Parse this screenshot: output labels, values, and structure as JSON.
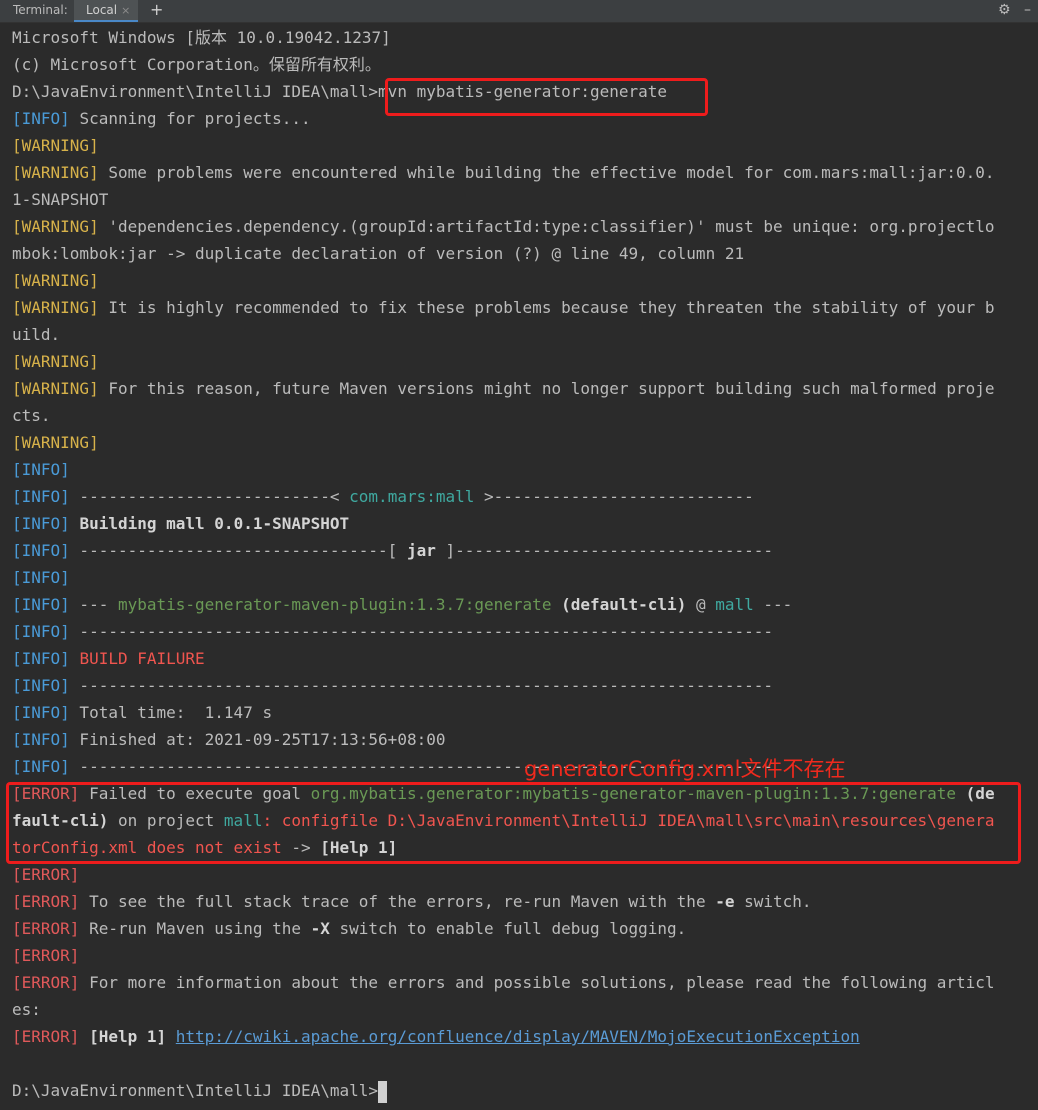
{
  "tabbar": {
    "title": "Terminal:",
    "tab_label": "Local",
    "tab_close": "×",
    "add": "+",
    "settings_icon": "gear-icon",
    "minimize_icon": "minimize-icon"
  },
  "lines": [
    {
      "segments": [
        {
          "t": "Microsoft Windows [版本 10.0.19042.1237]"
        }
      ]
    },
    {
      "segments": [
        {
          "t": "(c) Microsoft Corporation。保留所有权利。"
        }
      ]
    },
    {
      "segments": [
        {
          "t": "D:\\JavaEnvironment\\IntelliJ IDEA\\mall>mvn mybatis-generator:generate"
        }
      ]
    },
    {
      "segments": [
        {
          "t": "[",
          "c": "info"
        },
        {
          "t": "INFO",
          "c": "info"
        },
        {
          "t": "]",
          "c": "info"
        },
        {
          "t": " Scanning for projects..."
        }
      ]
    },
    {
      "segments": [
        {
          "t": "[WARNING]",
          "c": "warn"
        }
      ]
    },
    {
      "segments": [
        {
          "t": "[WARNING]",
          "c": "warn"
        },
        {
          "t": " Some problems were encountered while building the effective model for com.mars:mall:jar:0.0."
        }
      ]
    },
    {
      "segments": [
        {
          "t": "1-SNAPSHOT"
        }
      ]
    },
    {
      "segments": [
        {
          "t": "[WARNING]",
          "c": "warn"
        },
        {
          "t": " 'dependencies.dependency.(groupId:artifactId:type:classifier)' must be unique: org.projectlo"
        }
      ]
    },
    {
      "segments": [
        {
          "t": "mbok:lombok:jar -> duplicate declaration of version (?) @ line 49, column 21"
        }
      ]
    },
    {
      "segments": [
        {
          "t": "[WARNING]",
          "c": "warn"
        }
      ]
    },
    {
      "segments": [
        {
          "t": "[WARNING]",
          "c": "warn"
        },
        {
          "t": " It is highly recommended to fix these problems because they threaten the stability of your b"
        }
      ]
    },
    {
      "segments": [
        {
          "t": "uild."
        }
      ]
    },
    {
      "segments": [
        {
          "t": "[WARNING]",
          "c": "warn"
        }
      ]
    },
    {
      "segments": [
        {
          "t": "[WARNING]",
          "c": "warn"
        },
        {
          "t": " For this reason, future Maven versions might no longer support building such malformed proje"
        }
      ]
    },
    {
      "segments": [
        {
          "t": "cts."
        }
      ]
    },
    {
      "segments": [
        {
          "t": "[WARNING]",
          "c": "warn"
        }
      ]
    },
    {
      "segments": [
        {
          "t": "[INFO]",
          "c": "info"
        }
      ]
    },
    {
      "segments": [
        {
          "t": "[INFO]",
          "c": "info"
        },
        {
          "t": " --------------------------< "
        },
        {
          "t": "com.mars:mall",
          "c": "teal"
        },
        {
          "t": " >---------------------------"
        }
      ]
    },
    {
      "segments": [
        {
          "t": "[INFO]",
          "c": "info"
        },
        {
          "t": " "
        },
        {
          "t": "Building mall 0.0.1-SNAPSHOT",
          "c": "bold"
        }
      ]
    },
    {
      "segments": [
        {
          "t": "[INFO]",
          "c": "info"
        },
        {
          "t": " --------------------------------[ "
        },
        {
          "t": "jar",
          "c": "bold"
        },
        {
          "t": " ]---------------------------------"
        }
      ]
    },
    {
      "segments": [
        {
          "t": "[INFO]",
          "c": "info"
        }
      ]
    },
    {
      "segments": [
        {
          "t": "[INFO]",
          "c": "info"
        },
        {
          "t": " --- "
        },
        {
          "t": "mybatis-generator-maven-plugin:1.3.7:generate",
          "c": "green"
        },
        {
          "t": " "
        },
        {
          "t": "(default-cli)",
          "c": "bold"
        },
        {
          "t": " @ "
        },
        {
          "t": "mall",
          "c": "teal"
        },
        {
          "t": " ---"
        }
      ]
    },
    {
      "segments": [
        {
          "t": "[INFO]",
          "c": "info"
        },
        {
          "t": " ------------------------------------------------------------------------"
        }
      ]
    },
    {
      "segments": [
        {
          "t": "[INFO]",
          "c": "info"
        },
        {
          "t": " "
        },
        {
          "t": "BUILD FAILURE",
          "c": "red"
        }
      ]
    },
    {
      "segments": [
        {
          "t": "[INFO]",
          "c": "info"
        },
        {
          "t": " ------------------------------------------------------------------------"
        }
      ]
    },
    {
      "segments": [
        {
          "t": "[INFO]",
          "c": "info"
        },
        {
          "t": " Total time:  1.147 s"
        }
      ]
    },
    {
      "segments": [
        {
          "t": "[INFO]",
          "c": "info"
        },
        {
          "t": " Finished at: 2021-09-25T17:13:56+08:00"
        }
      ]
    },
    {
      "segments": [
        {
          "t": "[INFO]",
          "c": "info"
        },
        {
          "t": " ------------------------------------------------------------------------"
        }
      ]
    },
    {
      "segments": [
        {
          "t": "[ERROR]",
          "c": "err"
        },
        {
          "t": " Failed to execute goal "
        },
        {
          "t": "org.mybatis.generator:mybatis-generator-maven-plugin:1.3.7:generate",
          "c": "green"
        },
        {
          "t": " "
        },
        {
          "t": "(de",
          "c": "bold"
        }
      ]
    },
    {
      "segments": [
        {
          "t": "fault-cli)",
          "c": "bold"
        },
        {
          "t": " on project "
        },
        {
          "t": "mall",
          "c": "teal"
        },
        {
          "t": ": ",
          "c": "red"
        },
        {
          "t": "configfile D:\\JavaEnvironment\\IntelliJ IDEA\\mall\\src\\main\\resources\\genera",
          "c": "red"
        }
      ]
    },
    {
      "segments": [
        {
          "t": "torConfig.xml does not exist",
          "c": "red"
        },
        {
          "t": " -> "
        },
        {
          "t": "[Help 1]",
          "c": "bold"
        }
      ]
    },
    {
      "segments": [
        {
          "t": "[ERROR]",
          "c": "err"
        }
      ]
    },
    {
      "segments": [
        {
          "t": "[ERROR]",
          "c": "err"
        },
        {
          "t": " To see the full stack trace of the errors, re-run Maven with the "
        },
        {
          "t": "-e",
          "c": "bold"
        },
        {
          "t": " switch."
        }
      ]
    },
    {
      "segments": [
        {
          "t": "[ERROR]",
          "c": "err"
        },
        {
          "t": " Re-run Maven using the "
        },
        {
          "t": "-X",
          "c": "bold"
        },
        {
          "t": " switch to enable full debug logging."
        }
      ]
    },
    {
      "segments": [
        {
          "t": "[ERROR]",
          "c": "err"
        }
      ]
    },
    {
      "segments": [
        {
          "t": "[ERROR]",
          "c": "err"
        },
        {
          "t": " For more information about the errors and possible solutions, please read the following articl"
        }
      ]
    },
    {
      "segments": [
        {
          "t": "es:"
        }
      ]
    },
    {
      "segments": [
        {
          "t": "[ERROR]",
          "c": "err"
        },
        {
          "t": " "
        },
        {
          "t": "[Help 1]",
          "c": "bold"
        },
        {
          "t": " "
        },
        {
          "t": "http://cwiki.apache.org/confluence/display/MAVEN/MojoExecutionException",
          "c": "link"
        }
      ]
    },
    {
      "segments": [
        {
          "t": ""
        }
      ]
    },
    {
      "segments": [
        {
          "t": "D:\\JavaEnvironment\\IntelliJ IDEA\\mall>"
        }
      ],
      "cursor": true
    }
  ],
  "annotation": "generatorConfig.xml文件不存在"
}
